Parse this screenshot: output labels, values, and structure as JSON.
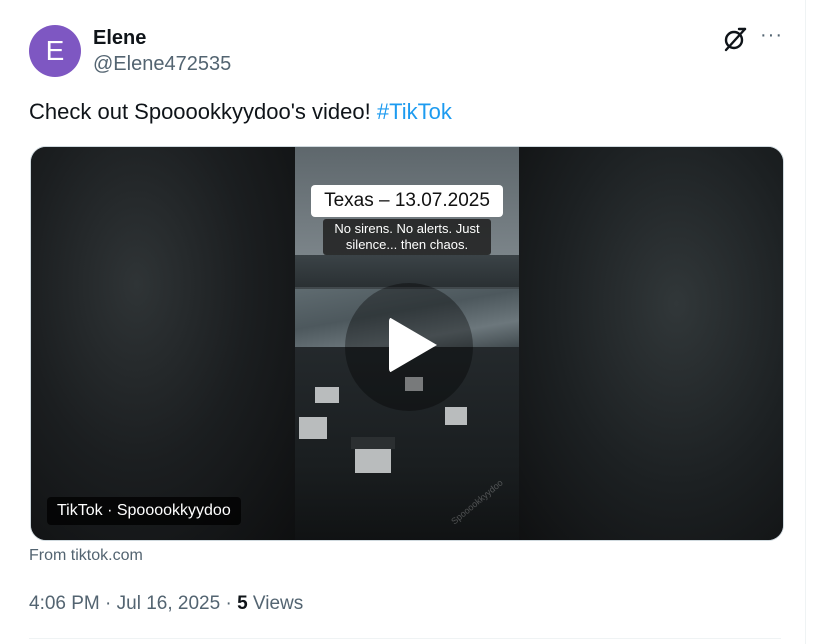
{
  "author": {
    "avatar_letter": "E",
    "avatar_color": "#7e57c2",
    "name": "Elene",
    "handle": "@Elene472535"
  },
  "header_icons": [
    "grok-icon",
    "more-icon"
  ],
  "more_label": "···",
  "tweet": {
    "text": "Check out Spooookkyydoo's video! ",
    "hashtag": "#TikTok",
    "hashtag_color": "#1d9bf0"
  },
  "media": {
    "video_title": "Texas – 13.07.2025",
    "video_subtitle_line1": "No sirens. No alerts. Just",
    "video_subtitle_line2": "silence... then chaos.",
    "watermark": "Spooookkyydoo",
    "source_badge": "TikTok · Spooookkyydoo",
    "play_icon": "play-icon"
  },
  "card_source": "From tiktok.com",
  "meta": {
    "time": "4:06 PM",
    "separator1": " · ",
    "date": "Jul 16, 2025",
    "separator2": " · ",
    "views_count": "5",
    "views_label": " Views"
  }
}
